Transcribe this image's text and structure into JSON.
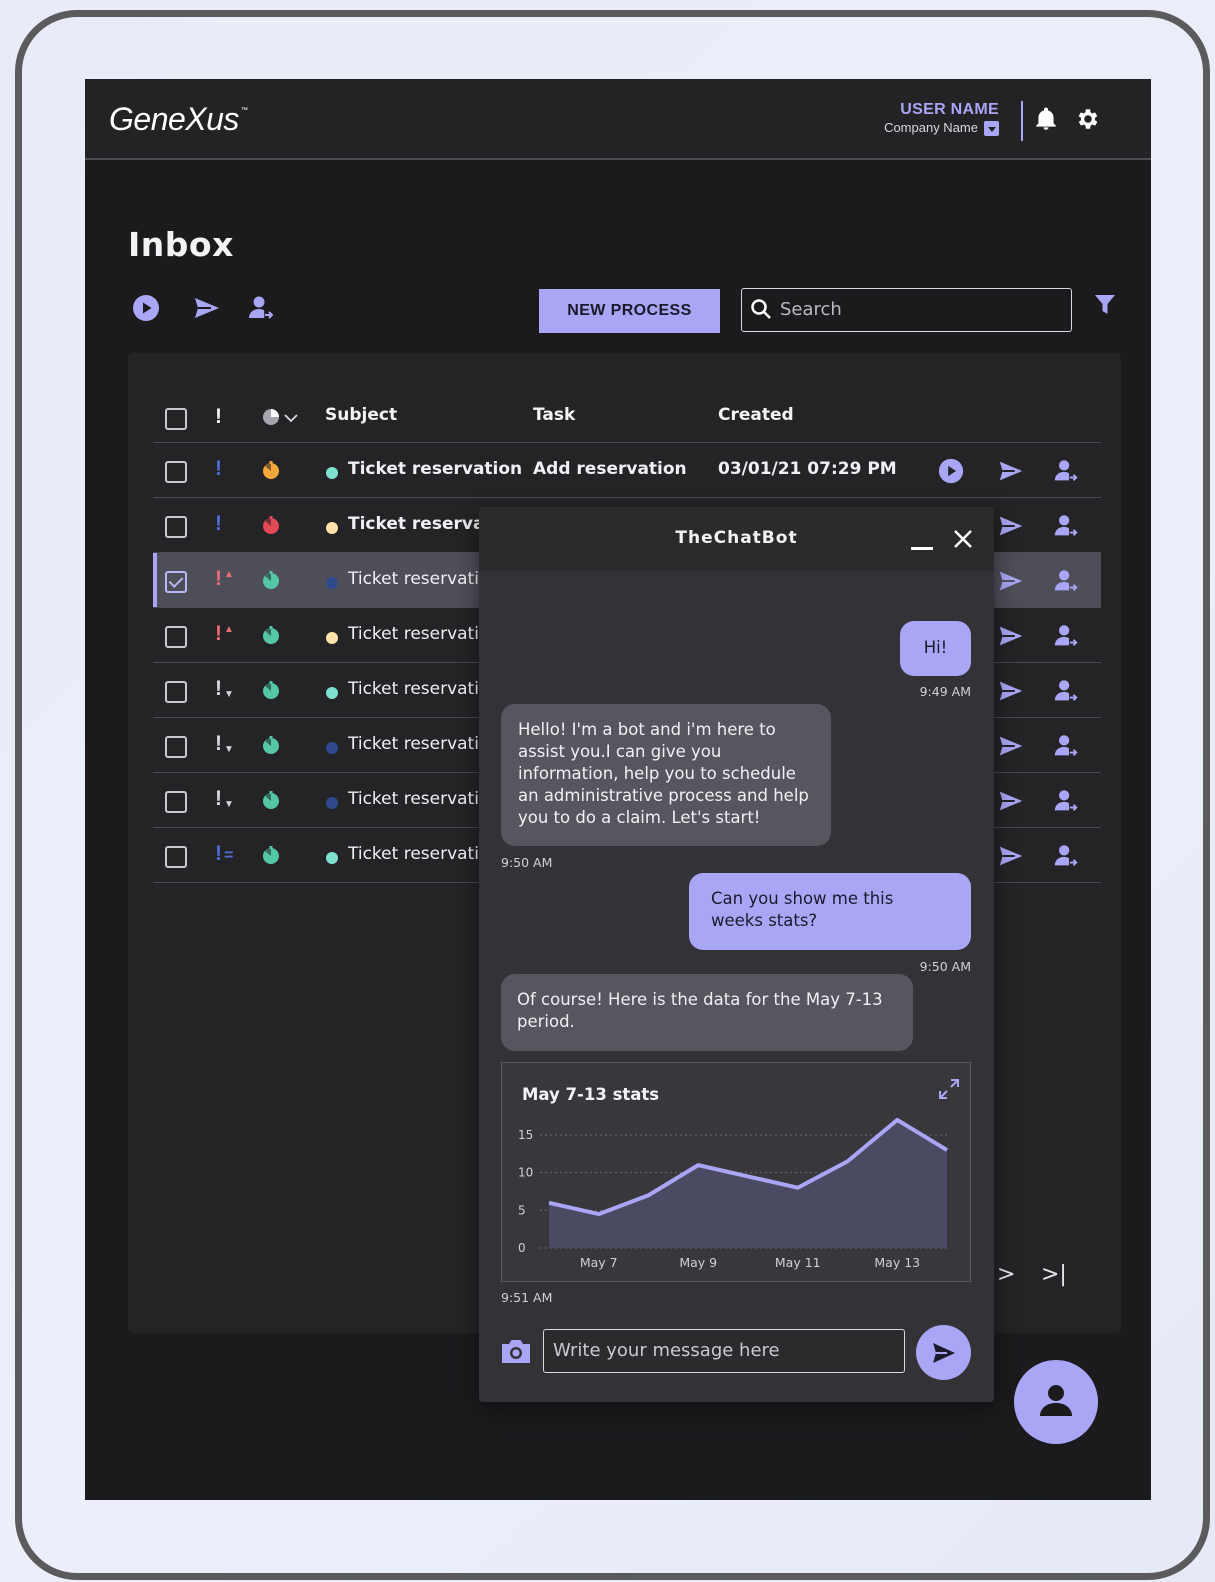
{
  "app": {
    "logo": "GeneXus",
    "logo_tm": "™"
  },
  "header": {
    "user_name": "USER NAME",
    "company_name": "Company Name"
  },
  "inbox": {
    "title": "Inbox",
    "new_process_label": "NEW PROCESS",
    "search_placeholder": "Search",
    "columns": {
      "subject": "Subject",
      "task": "Task",
      "created": "Created"
    },
    "rows": [
      {
        "priority": "!",
        "priority_color": "#4b6fd6",
        "timer_color": "#f3a73a",
        "status_color": "#7fe0d0",
        "subject": "Ticket reservation",
        "subject_bold": true,
        "task": "Add reservation",
        "created": "03/01/21 07:29 PM",
        "checked": false
      },
      {
        "priority": "!",
        "priority_color": "#4b6fd6",
        "timer_color": "#e24a57",
        "status_color": "#ffe3a8",
        "subject": "Ticket reservati",
        "subject_bold": true,
        "task": "",
        "created": "",
        "checked": false
      },
      {
        "priority": "!",
        "priority_color": "#e86b75",
        "priority_mod": "up",
        "timer_color": "#56c7a6",
        "status_color": "#2f4a8c",
        "subject": "Ticket reservati",
        "subject_bold": false,
        "task": "",
        "created": "",
        "checked": true
      },
      {
        "priority": "!",
        "priority_color": "#e86b75",
        "priority_mod": "up",
        "timer_color": "#56c7a6",
        "status_color": "#ffe3a8",
        "subject": "Ticket reservati",
        "subject_bold": false,
        "task": "",
        "created": "",
        "checked": false
      },
      {
        "priority": "!",
        "priority_color": "#d8d8de",
        "priority_mod": "down",
        "timer_color": "#56c7a6",
        "status_color": "#7fe0d0",
        "subject": "Ticket reservati",
        "subject_bold": false,
        "task": "",
        "created": "",
        "checked": false
      },
      {
        "priority": "!",
        "priority_color": "#d8d8de",
        "priority_mod": "down",
        "timer_color": "#56c7a6",
        "status_color": "#2f4a8c",
        "subject": "Ticket reservati",
        "subject_bold": false,
        "task": "",
        "created": "",
        "checked": false
      },
      {
        "priority": "!",
        "priority_color": "#d8d8de",
        "priority_mod": "down",
        "timer_color": "#56c7a6",
        "status_color": "#2f4a8c",
        "subject": "Ticket reservati",
        "subject_bold": false,
        "task": "",
        "created": "",
        "checked": false
      },
      {
        "priority": "!",
        "priority_color": "#4b6fd6",
        "priority_mod": "equal",
        "timer_color": "#56c7a6",
        "status_color": "#7fe0d0",
        "subject": "Ticket reservati",
        "subject_bold": false,
        "task": "",
        "created": "",
        "checked": false
      }
    ]
  },
  "chat": {
    "title": "TheChatBot",
    "messages": [
      {
        "from": "me",
        "text": "Hi!",
        "time": "9:49 AM"
      },
      {
        "from": "bot",
        "text": "Hello! I'm a bot and i'm here to assist you.I can give you information, help you to schedule an administrative process and help you to do a claim. Let's start!",
        "time": "9:50 AM"
      },
      {
        "from": "me",
        "text": "Can you show me this weeks stats?",
        "time": "9:50 AM"
      },
      {
        "from": "bot",
        "text": "Of course! Here is the data for the May 7-13 period.",
        "time": ""
      },
      {
        "from": "bot",
        "type": "chart",
        "time": "9:51 AM"
      }
    ],
    "input_placeholder": "Write your message here"
  },
  "chart_data": {
    "type": "area",
    "title": "May 7-13 stats",
    "x": [
      "May 6",
      "May 7",
      "May 8",
      "May 9",
      "May 10",
      "May 11",
      "May 12",
      "May 13",
      "May 14"
    ],
    "x_tick_labels": [
      "May 7",
      "May 9",
      "May 11",
      "May 13"
    ],
    "y_tick_labels": [
      "0",
      "5",
      "10",
      "15"
    ],
    "values": [
      6,
      4.5,
      7,
      11,
      9.5,
      8,
      11.5,
      17,
      13
    ],
    "ylim": [
      0,
      15
    ],
    "grid": true,
    "colors": {
      "line": "#a9a6f5",
      "fill": "#4b4a63"
    }
  },
  "colors": {
    "accent": "#a9a6f5",
    "background": "#1b1b1e",
    "panel": "#242427"
  },
  "icons": {
    "bell": "bell-icon",
    "gear": "gear-icon",
    "play": "play-icon",
    "send": "send-icon",
    "assign": "assign-user-icon",
    "filter": "filter-icon",
    "search": "search-icon",
    "camera": "camera-icon",
    "expand": "expand-icon",
    "close": "close-icon",
    "minimize": "minimize-icon",
    "user": "user-icon",
    "next": "next-page-icon",
    "last": "last-page-icon"
  }
}
